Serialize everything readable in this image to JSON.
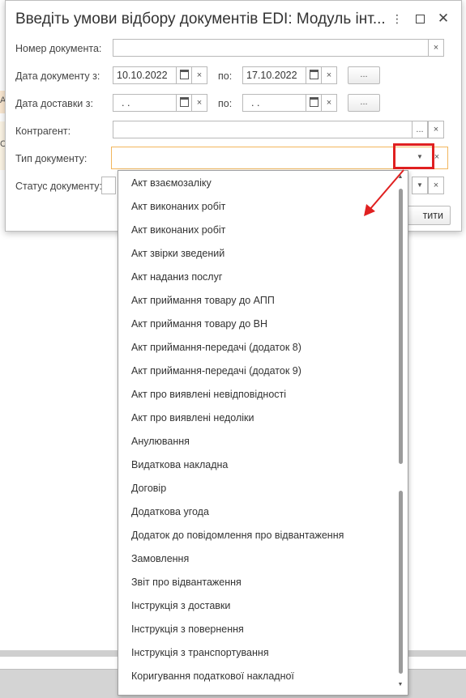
{
  "dialog": {
    "title": "Введіть умови відбору документів EDI: Модуль інт...",
    "fields": {
      "doc_number_label": "Номер документа:",
      "doc_date_label": "Дата документу з:",
      "doc_date_from": "10.10.2022",
      "doc_date_to_label": "по:",
      "doc_date_to": "17.10.2022",
      "delivery_date_label": "Дата доставки з:",
      "delivery_date_from": " .  .",
      "delivery_date_to_label": "по:",
      "delivery_date_to": " .  .",
      "counterparty_label": "Контрагент:",
      "doc_type_label": "Тип документу:",
      "doc_status_label": "Статус документу:"
    },
    "ellipsis_label": "...",
    "clear_label": "×",
    "ok_button_label": "тити"
  },
  "background": {
    "left_fragment_1": "A",
    "left_fragment_2": "С"
  },
  "dropdown": {
    "items": [
      "Акт взаємозаліку",
      "Акт виконаних робіт",
      "Акт виконаних робіт",
      "Акт звірки зведений",
      "Акт наданиз послуг",
      "Акт приймання товару до АПП",
      "Акт приймання товару до ВН",
      "Акт приймання-передачі (додаток 8)",
      "Акт приймання-передачі (додаток 9)",
      "Акт про виявлені невідповідності",
      "Акт про виявлені недоліки",
      "Анулювання",
      "Видаткова накладна",
      "Договір",
      "Додаткова угода",
      "Додаток до повідомлення про відвантаження",
      "Замовлення",
      "Звіт про відвантаження",
      "Інструкція з доставки",
      "Інструкція з повернення",
      "Інструкція з транспортування",
      "Коригування податкової накладної"
    ]
  },
  "colors": {
    "focus_border": "#f2b65d",
    "annotation_red": "#e02020"
  }
}
